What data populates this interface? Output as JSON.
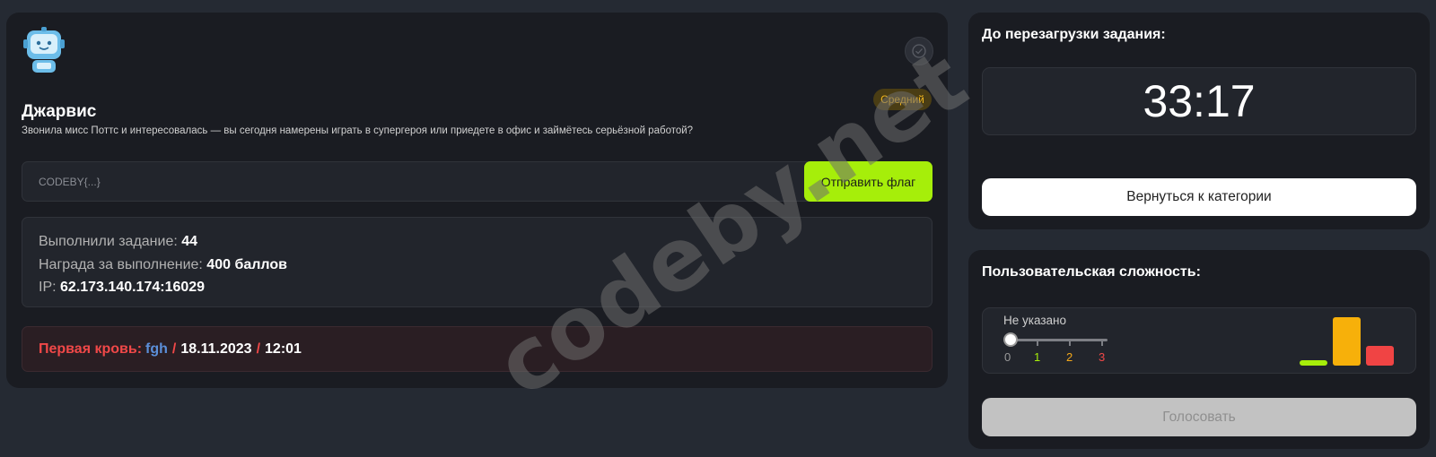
{
  "task": {
    "avatar_icon": "robot-avatar",
    "solved_icon": "check-circle-icon",
    "title": "Джарвис",
    "difficulty_badge": "Средний",
    "description": "Звонила мисс Поттс и интересовалась — вы сегодня намерены играть в супергероя или приедете в офис и займётесь серьёзной работой?",
    "flag_placeholder": "CODEBY{...}",
    "submit_label": "Отправить флаг",
    "stats": {
      "solved_label": "Выполнили задание: ",
      "solved_value": "44",
      "reward_label": "Награда за выполнение: ",
      "reward_value": "400 баллов",
      "ip_label": "IP: ",
      "ip_value": "62.173.140.174:16029"
    },
    "first_blood": {
      "label": "Первая кровь:",
      "user": "fgh",
      "separator": "/",
      "date": "18.11.2023",
      "time": "12:01"
    }
  },
  "timer": {
    "title": "До перезагрузки задания:",
    "value": "33:17",
    "back_label": "Вернуться к категории"
  },
  "vote": {
    "title": "Пользовательская сложность:",
    "current": "Не указано",
    "scale": [
      "0",
      "1",
      "2",
      "3"
    ],
    "scale_colors": [
      "#9a9a9a",
      "#a6ee0a",
      "#f3a81a",
      "#f04848"
    ],
    "bars": [
      {
        "level": "1",
        "color": "#a6ee0a",
        "height_fraction": 0.1
      },
      {
        "level": "2",
        "color": "#f7b00a",
        "height_fraction": 1.0
      },
      {
        "level": "3",
        "color": "#f04444",
        "height_fraction": 0.4
      }
    ],
    "vote_label": "Голосовать"
  },
  "watermark": "codeby.net"
}
